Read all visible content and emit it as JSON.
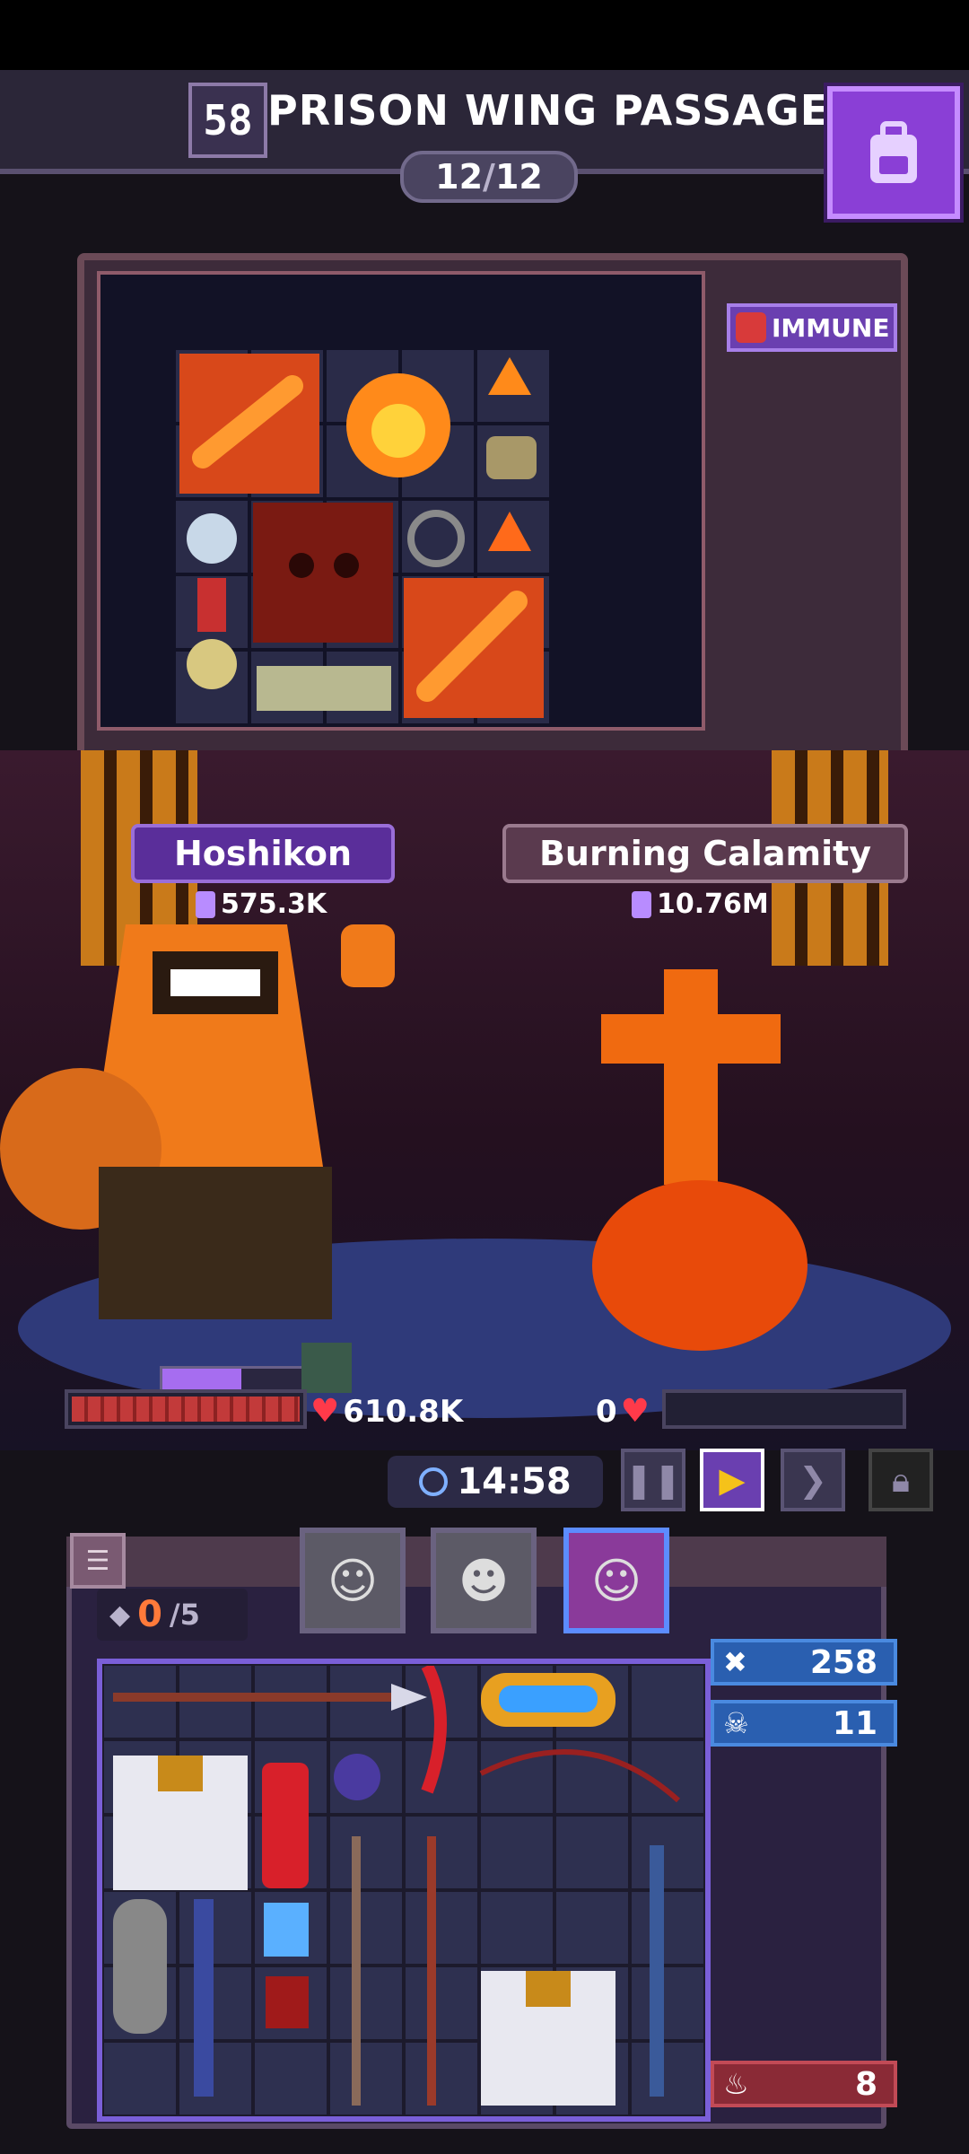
{
  "header": {
    "level": "58",
    "stage_title": "PRISON WING PASSAGE",
    "wave_current": "12",
    "wave_separator": "/",
    "wave_total": "12"
  },
  "enemy_board": {
    "immune_label": "IMMUNE"
  },
  "player": {
    "name": "Hoshikon",
    "power": "575.3K",
    "hp": "610.8K",
    "hp_fill": 1.0,
    "mana_fill": 0.55
  },
  "enemy": {
    "name": "Burning Calamity",
    "power": "10.76M",
    "hp": "0",
    "hp_fill": 0.0
  },
  "timer": {
    "value": "14:58"
  },
  "backpack": {
    "slots_used": "0",
    "slots_max": "/5",
    "stats": [
      {
        "icon": "crossed-swords-icon",
        "value": "258"
      },
      {
        "icon": "skull-icon",
        "value": "11"
      },
      {
        "icon": "flame-icon",
        "value": "8"
      }
    ]
  },
  "colors": {
    "accent_purple": "#8a3fd6",
    "hp_red": "#c23a3a",
    "enemy_orange": "#f06a10"
  }
}
